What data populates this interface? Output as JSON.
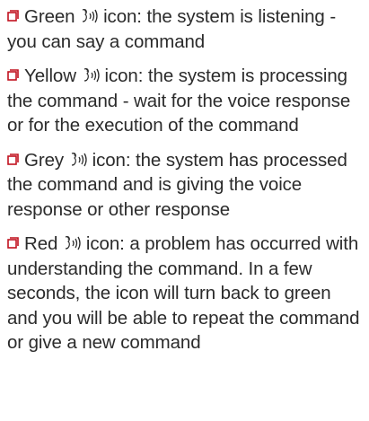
{
  "items": [
    {
      "color_word": "Green",
      "text": "icon: the system is listening - you can say a command",
      "bullet_icon": "square-bullet-icon",
      "voice_icon": "voice-command-icon"
    },
    {
      "color_word": "Yellow",
      "text": "icon: the system is processing the command - wait for the voice response or for the execution of the command",
      "bullet_icon": "square-bullet-icon",
      "voice_icon": "voice-command-icon"
    },
    {
      "color_word": "Grey",
      "text": "icon: the system has processed the command and is giving the voice response or other response",
      "bullet_icon": "square-bullet-icon",
      "voice_icon": "voice-command-icon"
    },
    {
      "color_word": "Red",
      "text": "icon: a problem has occurred with understanding the command. In a few seconds, the icon will turn back to green and you will be able to repeat the command or give a new command",
      "bullet_icon": "square-bullet-icon",
      "voice_icon": "voice-command-icon"
    }
  ],
  "colors": {
    "text": "#2b2b2b",
    "bullet": "#c1121f",
    "background": "#ffffff"
  }
}
